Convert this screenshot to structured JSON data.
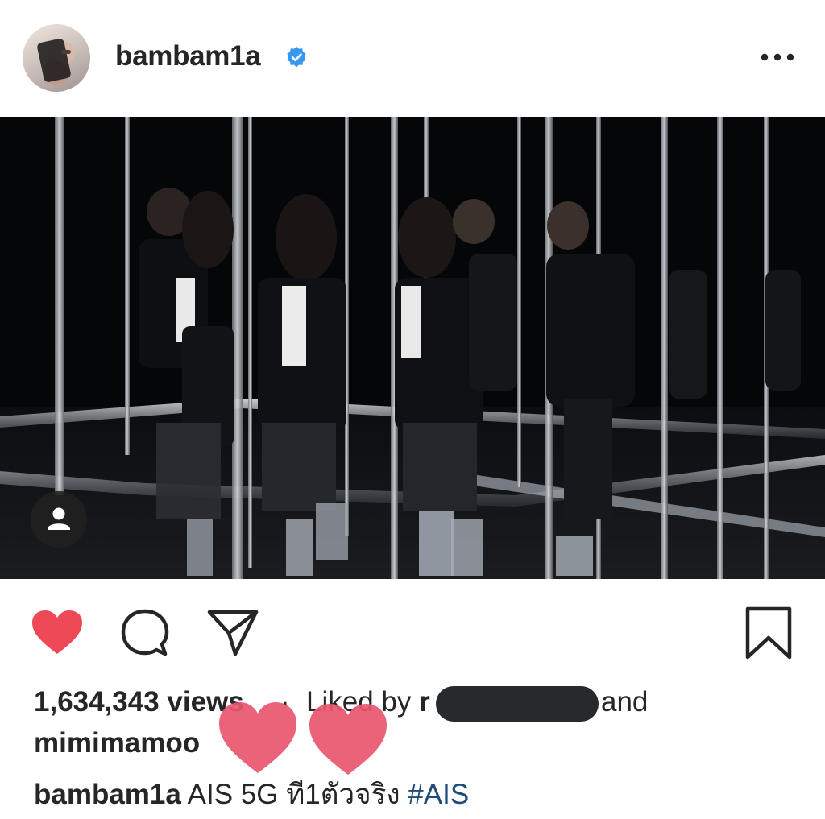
{
  "header": {
    "username": "bambam1a",
    "verified": true,
    "more_icon": "more-horizontal-icon"
  },
  "post": {
    "media_type": "video",
    "user_tag_icon": "user-tag-icon"
  },
  "actions": {
    "like_icon": "heart-filled-icon",
    "comment_icon": "comment-icon",
    "share_icon": "direct-send-icon",
    "save_icon": "bookmark-icon",
    "like_color": "#ED4956"
  },
  "engagement": {
    "views": "1,634,343 views",
    "separator": "·",
    "liked_by_prefix": "Liked by",
    "liked_by_user_initial": "r",
    "and_text": "and",
    "second_liker": "mimimamoo"
  },
  "caption": {
    "username": "bambam1a",
    "text": "AIS 5G ที1ตัวจริง",
    "hashtag": "#AIS"
  },
  "colors": {
    "text": "#262626",
    "verified_blue": "#3897F0",
    "hashtag": "#1F4B7A",
    "sticker_heart": "#E8566C"
  }
}
